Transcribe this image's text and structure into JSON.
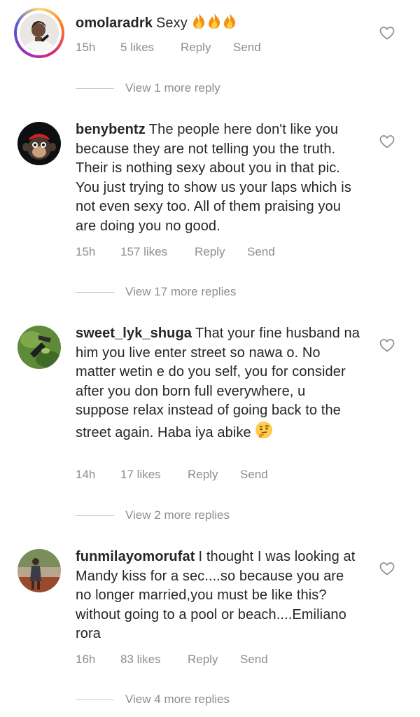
{
  "comments": [
    {
      "username": "omolaradrk",
      "text": "Sexy",
      "emoji": [
        "fire-emoji",
        "fire-emoji",
        "fire-emoji"
      ],
      "time": "15h",
      "likes": "5 likes",
      "reply": "Reply",
      "send": "Send",
      "view_more": "View 1 more reply",
      "has_story_ring": true
    },
    {
      "username": "benybentz",
      "text": "The people here don't like you because they are not telling you the truth. Their is nothing sexy about you in that pic. You just trying to show us your laps which is not even sexy too. All of them praising you are doing you no good.",
      "time": "15h",
      "likes": "157 likes",
      "reply": "Reply",
      "send": "Send",
      "view_more": "View 17 more replies"
    },
    {
      "username": "sweet_lyk_shuga",
      "text": "That your fine husband na him you live enter street so nawa o. No matter wetin e do you self, you for consider after you don born full everywhere, u suppose relax instead of going back to the street again. Haba iya abike",
      "emoji": [
        "thinking-face-emoji"
      ],
      "time": "14h",
      "likes": "17 likes",
      "reply": "Reply",
      "send": "Send",
      "view_more": "View 2 more replies"
    },
    {
      "username": "funmilayomorufat",
      "text": "I thought I was looking at Mandy kiss for a sec....so because you are no longer married,you must be like this?without going to a pool or beach....Emiliano rora",
      "time": "16h",
      "likes": "83 likes",
      "reply": "Reply",
      "send": "Send",
      "view_more": "View 4 more replies"
    }
  ],
  "colors": {
    "text": "#262626",
    "secondary": "#8e8e8e",
    "divider": "#c7c7c7",
    "story_ring": [
      "#feda75",
      "#fa7e1e",
      "#d62976",
      "#962fbf",
      "#4f5bd5"
    ]
  },
  "icons": {
    "like": "heart-outline-icon"
  }
}
